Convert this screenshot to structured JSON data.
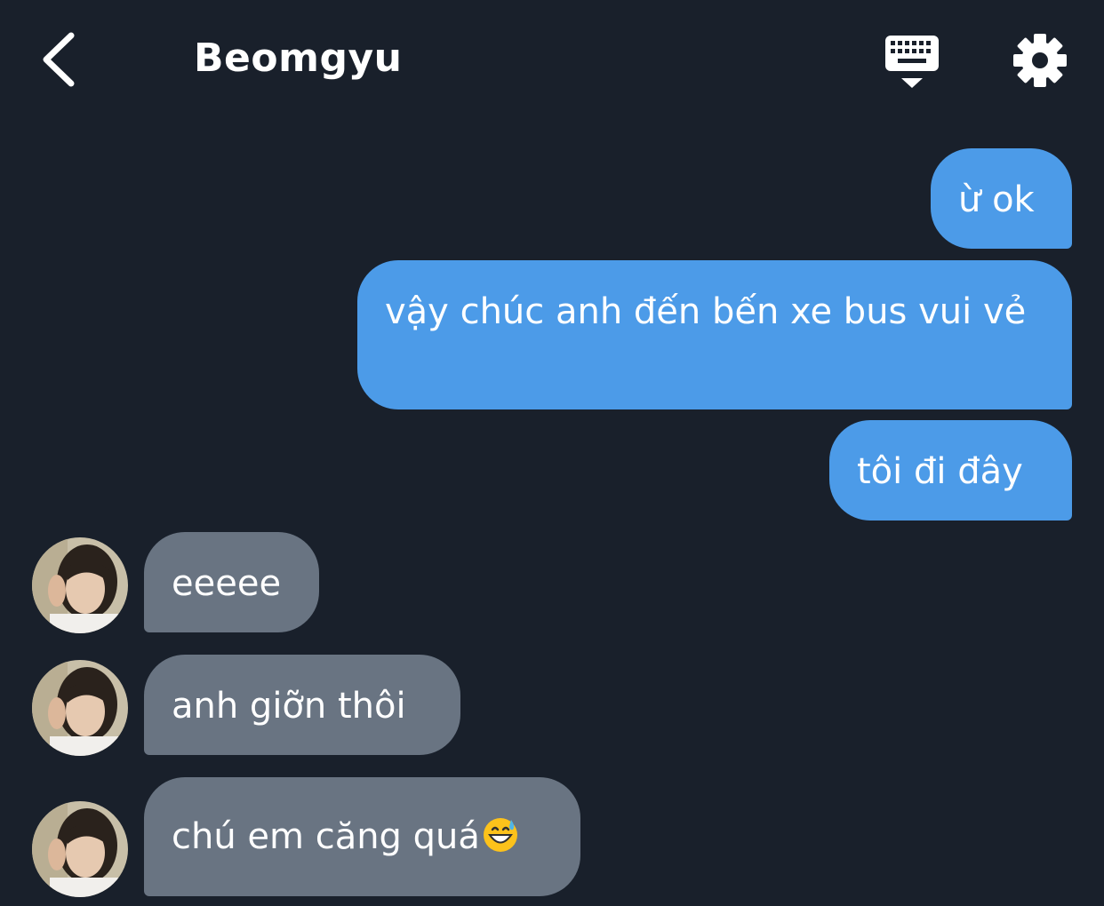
{
  "header": {
    "title": "Beomgyu",
    "back_icon": "chevron-left-icon",
    "keyboard_icon": "keyboard-icon",
    "settings_icon": "gear-icon"
  },
  "colors": {
    "background": "#19202b",
    "outgoing_bubble": "#4c9be8",
    "incoming_bubble": "#697482",
    "text": "#ffffff"
  },
  "messages": [
    {
      "direction": "out",
      "text": "ừ ok"
    },
    {
      "direction": "out",
      "text": "vậy chúc anh đến bến xe bus vui vẻ"
    },
    {
      "direction": "out",
      "text": "tôi đi đây"
    },
    {
      "direction": "in",
      "text": "eeeee"
    },
    {
      "direction": "in",
      "text": "anh giỡn thôi"
    },
    {
      "direction": "in",
      "text": "chú em căng quá",
      "emoji": "grinning-face-with-sweat-emoji"
    }
  ]
}
